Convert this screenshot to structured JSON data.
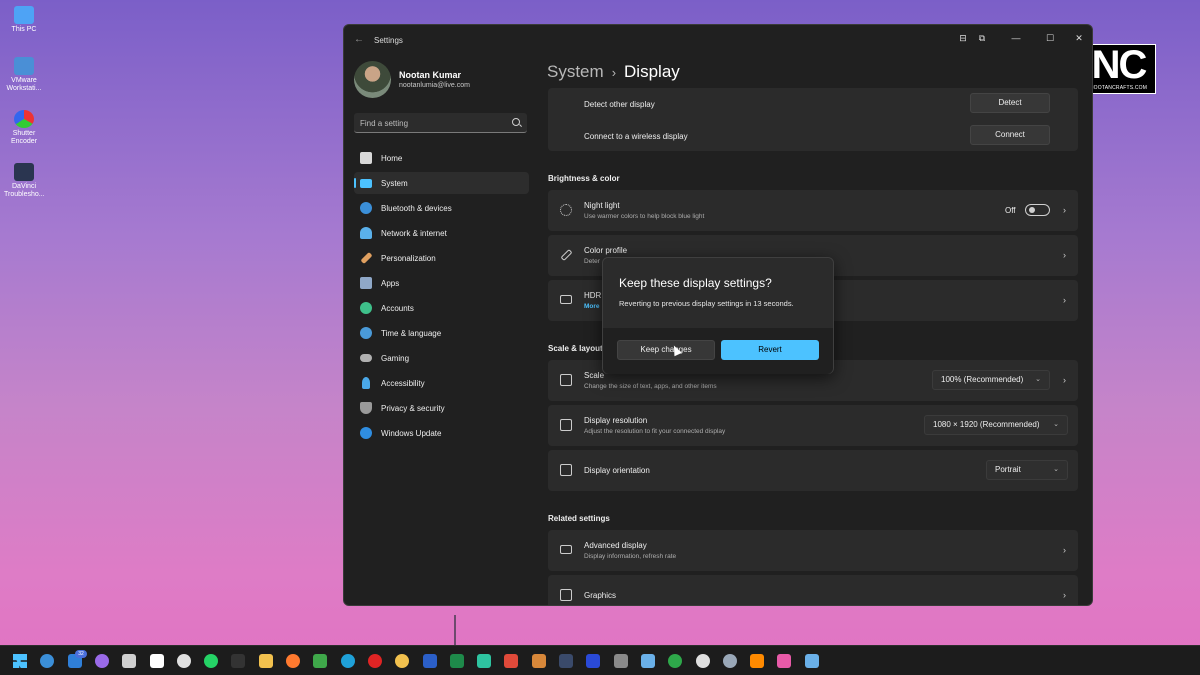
{
  "desktop": {
    "icons": [
      {
        "label": "This PC",
        "color": "#4ea3f5"
      },
      {
        "label": "VMware Workstati...",
        "color": "#4a8fd6"
      },
      {
        "label": "Shutter Encoder",
        "color": "#ffffff"
      },
      {
        "label": "DaVinci Troublesho...",
        "color": "#2a3550"
      }
    ]
  },
  "watermark": {
    "text": "NC",
    "subtext": "NOOTANCRAFTS.COM"
  },
  "window": {
    "title": "Settings",
    "controls": {
      "minimize": "—",
      "maximize": "☐",
      "close": "✕"
    }
  },
  "profile": {
    "name": "Nootan Kumar",
    "email": "nootanlumia@live.com"
  },
  "search": {
    "placeholder": "Find a setting"
  },
  "nav": [
    {
      "label": "Home",
      "icon": "home-icon",
      "color": "#d9d9d9"
    },
    {
      "label": "System",
      "icon": "system-icon",
      "color": "#4cc2ff",
      "active": true
    },
    {
      "label": "Bluetooth & devices",
      "icon": "bluetooth-icon",
      "color": "#3b8fd8"
    },
    {
      "label": "Network & internet",
      "icon": "network-icon",
      "color": "#5ab0ea"
    },
    {
      "label": "Personalization",
      "icon": "brush-icon",
      "color": "#e0a060"
    },
    {
      "label": "Apps",
      "icon": "apps-icon",
      "color": "#8fa8c8"
    },
    {
      "label": "Accounts",
      "icon": "accounts-icon",
      "color": "#3ec08a"
    },
    {
      "label": "Time & language",
      "icon": "clock-globe-icon",
      "color": "#4a9ad8"
    },
    {
      "label": "Gaming",
      "icon": "gamepad-icon",
      "color": "#b0b0b0"
    },
    {
      "label": "Accessibility",
      "icon": "accessibility-icon",
      "color": "#4aa8e8"
    },
    {
      "label": "Privacy & security",
      "icon": "shield-icon",
      "color": "#9a9a9a"
    },
    {
      "label": "Windows Update",
      "icon": "update-icon",
      "color": "#2f8de0"
    }
  ],
  "breadcrumb": {
    "parent": "System",
    "separator": "›",
    "current": "Display"
  },
  "main": {
    "detect_row": {
      "title": "Detect other display",
      "button": "Detect"
    },
    "connect_row": {
      "title": "Connect to a wireless display",
      "button": "Connect"
    },
    "brightness_header": "Brightness & color",
    "night_light": {
      "title": "Night light",
      "subtitle": "Use warmer colors to help block blue light",
      "state": "Off",
      "toggle_on": false
    },
    "color_profile": {
      "title": "Color profile",
      "subtitle": "Deter"
    },
    "hdr": {
      "title": "HDR",
      "subtitle": "More"
    },
    "scale_header": "Scale & layout",
    "scale": {
      "title": "Scale",
      "subtitle": "Change the size of text, apps, and other items",
      "value": "100% (Recommended)"
    },
    "resolution": {
      "title": "Display resolution",
      "subtitle": "Adjust the resolution to fit your connected display",
      "value": "1080 × 1920 (Recommended)"
    },
    "orientation": {
      "title": "Display orientation",
      "value": "Portrait"
    },
    "related_header": "Related settings",
    "advanced": {
      "title": "Advanced display",
      "subtitle": "Display information, refresh rate"
    },
    "graphics": {
      "title": "Graphics"
    }
  },
  "dialog": {
    "title": "Keep these display settings?",
    "message": "Reverting to previous display settings in 13 seconds.",
    "keep_button": "Keep changes",
    "revert_button": "Revert"
  },
  "taskbar": {
    "badge_count": "32",
    "icons": [
      {
        "name": "start-icon",
        "color": "#4cc2ff"
      },
      {
        "name": "info-icon",
        "color": "#3b8fd8"
      },
      {
        "name": "mail-icon",
        "color": "#2f7fd8"
      },
      {
        "name": "copilot-icon",
        "color": "#9a6ae8"
      },
      {
        "name": "cloud-icon",
        "color": "#d0d0d0"
      },
      {
        "name": "store-icon",
        "color": "#ffffff"
      },
      {
        "name": "chatgpt-icon",
        "color": "#e0e0e0"
      },
      {
        "name": "whatsapp-icon",
        "color": "#25d366"
      },
      {
        "name": "terminal-icon",
        "color": "#333333"
      },
      {
        "name": "folder-icon",
        "color": "#f2c14e"
      },
      {
        "name": "firefox-icon",
        "color": "#ff7a2f"
      },
      {
        "name": "browser-icon",
        "color": "#3fa84a"
      },
      {
        "name": "edge-icon",
        "color": "#1fa1d8"
      },
      {
        "name": "opera-icon",
        "color": "#e02424"
      },
      {
        "name": "chrome-icon",
        "color": "#f2c14e"
      },
      {
        "name": "word-icon",
        "color": "#2b5fc8"
      },
      {
        "name": "excel-icon",
        "color": "#1e8a4a"
      },
      {
        "name": "app-icon",
        "color": "#2ec4a0"
      },
      {
        "name": "screenshot-icon",
        "color": "#e04a3a"
      },
      {
        "name": "game-icon",
        "color": "#d8883a"
      },
      {
        "name": "davinci-icon",
        "color": "#3a4a6a"
      },
      {
        "name": "photoshop-icon",
        "color": "#2a4ad8"
      },
      {
        "name": "calculator-icon",
        "color": "#8a8a8a"
      },
      {
        "name": "notepad-icon",
        "color": "#6ab0e8"
      },
      {
        "name": "xbox-icon",
        "color": "#2ea84a"
      },
      {
        "name": "moon-icon",
        "color": "#e0e0e0"
      },
      {
        "name": "settings-icon",
        "color": "#9aa8b8"
      },
      {
        "name": "vlc-icon",
        "color": "#ff8a00"
      },
      {
        "name": "media-icon",
        "color": "#e85aa8"
      },
      {
        "name": "tools-icon",
        "color": "#6ab0e8"
      }
    ]
  }
}
